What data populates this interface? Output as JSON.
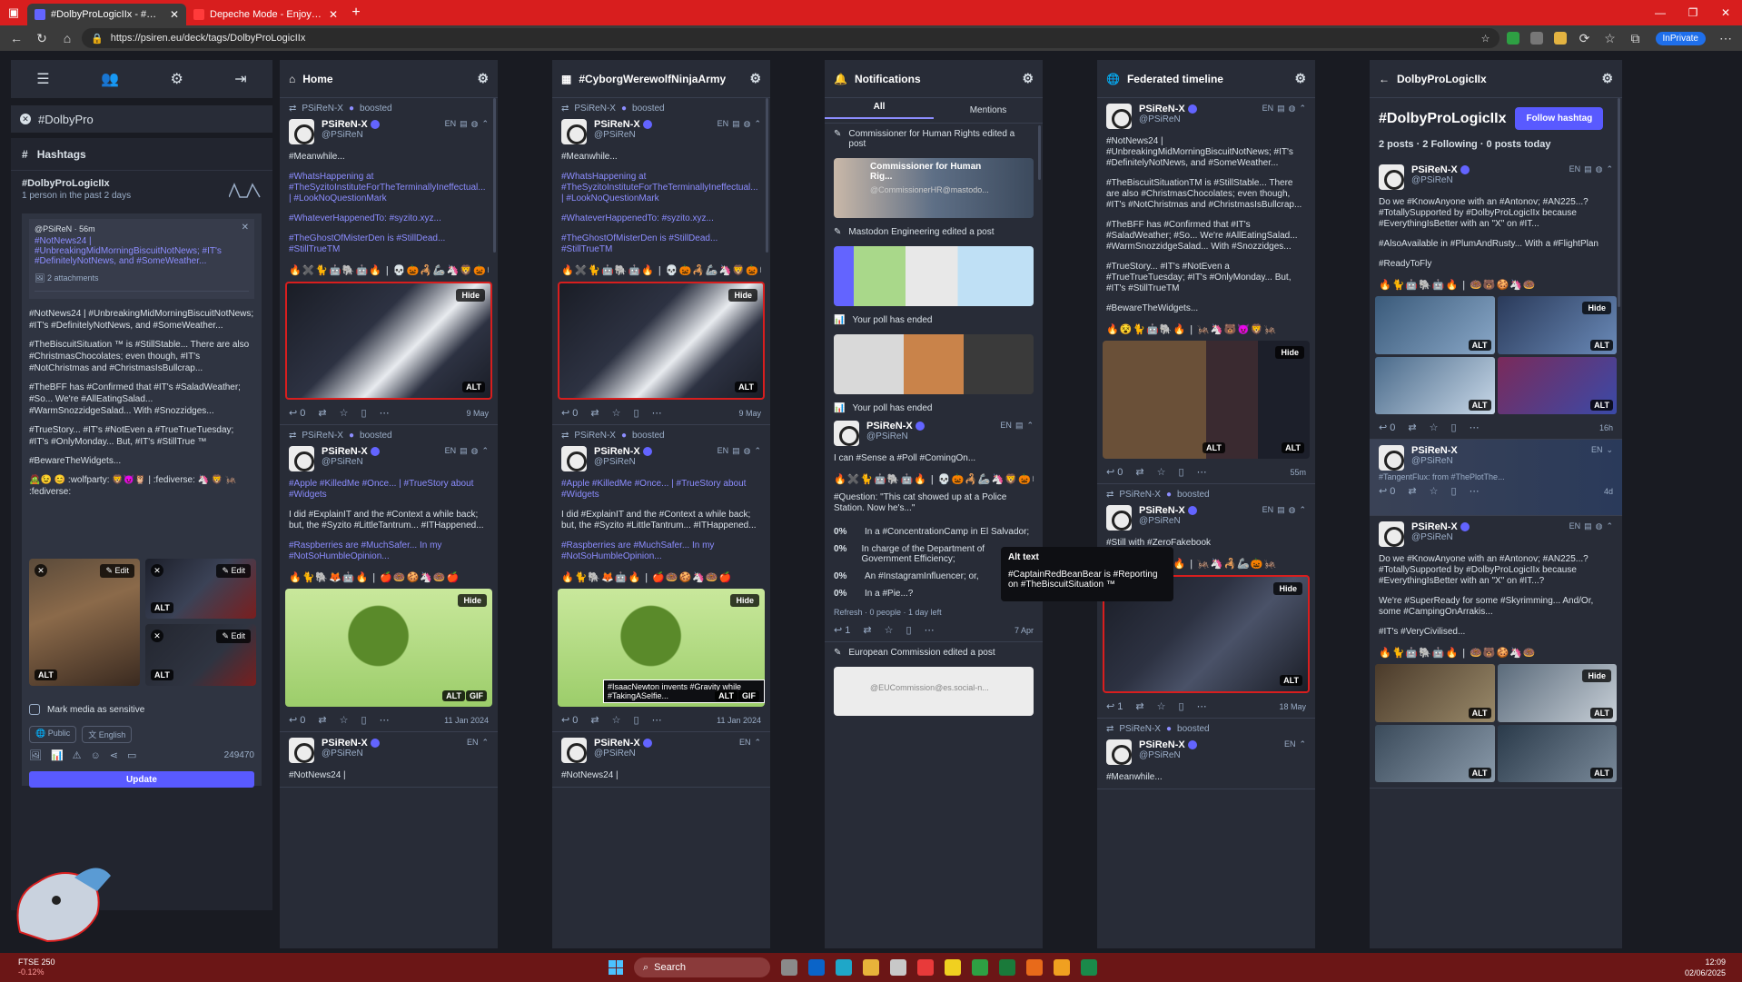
{
  "browser": {
    "tabs": [
      {
        "label": "#DolbyProLogicIIx - #Mastodon..."
      },
      {
        "label": "Depeche Mode - Enjoy The Silence"
      }
    ],
    "url": "https://psiren.eu/deck/tags/DolbyProLogicIIx",
    "inprivate": "InPrivate"
  },
  "left": {
    "search_chip": "#DolbyPro",
    "hashtags_title": "Hashtags",
    "trend_name": "#DolbyProLogicIIx",
    "trend_sub": "1 person in the past 2 days",
    "reply_header": "@PSiReN · 56m",
    "reply_text": "#NotNews24 | #UnbreakingMidMorningBiscuitNotNews; #IT's #DefinitelyNotNews, and #SomeWeather...",
    "attachments": "2 attachments",
    "compose_paras": [
      "#NotNews24 | #UnbreakingMidMorningBiscuitNotNews; #IT's #DefinitelyNotNews, and #SomeWeather...",
      "#TheBiscuitSituation ™ is #StillStable... There are also #ChristmasChocolates; even though, #IT's #NotChristmas and #ChristmasIsBullcrap...",
      "#TheBFF has #Confirmed that #IT's #SaladWeather; #So... We're #AllEatingSalad... #WarmSnozzidgeSalad... With #Snozzidges...",
      "#TrueStory... #IT's #NotEven a #TrueTrueTuesday; #IT's #OnlyMonday... But, #IT's #StillTrue ™",
      "#BewareTheWidgets...",
      "🧟😉 😊 :wolfparty: 🦁😈🦉 | :fediverse: 🦄 🦁 🦗 :fediverse:"
    ],
    "edit": "Edit",
    "alt": "ALT",
    "sensitive": "Mark media as sensitive",
    "visibility": "Public",
    "language": "English",
    "char_count": "249470",
    "update": "Update"
  },
  "columns": {
    "home": {
      "title": "Home"
    },
    "cyborg": {
      "title": "#CyborgWerewolfNinjaArmy"
    },
    "notifications": {
      "title": "Notifications",
      "tab_all": "All",
      "tab_mentions": "Mentions"
    },
    "federated": {
      "title": "Federated timeline"
    },
    "hashtag": {
      "title": "DolbyProLogicIIx"
    }
  },
  "post": {
    "booster": "PSiReN-X",
    "boosted": "boosted",
    "name": "PSiReN-X",
    "handle": "@PSiReN",
    "lang": "EN",
    "hide": "Hide",
    "alt": "ALT",
    "gif": "GIF",
    "p1": [
      "#Meanwhile...",
      "#WhatsHappening at #TheSyzitoInstituteForTheTerminallyIneffectual... | #LookNoQuestionMark",
      "#WhateverHappenedTo: #syzito.xyz...",
      "#TheGhostOfMisterDen is #StillDead... #StillTrueTM"
    ],
    "p1_emoji": "🔥✖️🐈🤖🐘🤖🔥 | 💀🎃🦂🦾🦄🦁🎃💀",
    "p1_date": "9 May",
    "p1_replies": "0",
    "p2": [
      "#Apple #KilledMe #Once... | #TrueStory about #Widgets",
      "I did #ExplainIT and the #Context a while back; but, the #Syzito #LittleTantrum... #ITHappened...",
      "#Raspberries are #MuchSafer... In my #NotSoHumbleOpinion..."
    ],
    "p2_emoji": "🔥🐈🐘🦊🤖🔥 | 🍎🍩🍪🦄🍩🍎",
    "p2_date": "11 Jan 2024",
    "p2_replies": "0",
    "newton_alt": "#IsaacNewton invents #Gravity while #TakingASelfie...",
    "p3_start": "#NotNews24 |"
  },
  "notifications": {
    "n1": "Commissioner for Human Rights edited a post",
    "n1_card_title": "Commissioner for Human Rig...",
    "n1_card_sub": "@CommissionerHR@mastodo...",
    "n2": "Mastodon Engineering edited a post",
    "n3": "Your poll has ended",
    "n4": "Your poll has ended",
    "poll_text": "I can #Sense a #Poll #ComingOn...",
    "poll_q": "#Question: \"This cat showed up at a Police Station. Now he's...\"",
    "poll_opts": [
      {
        "pct": "0%",
        "label": "In a #ConcentrationCamp in El Salvador;"
      },
      {
        "pct": "0%",
        "label": "In charge of the Department of Government Efficiency;"
      },
      {
        "pct": "0%",
        "label": "An #InstagramInfluencer; or,"
      },
      {
        "pct": "0%",
        "label": "In a #Pie...?"
      }
    ],
    "poll_foot": "Refresh · 0 people · 1 day left",
    "poll_date": "7 Apr",
    "poll_replies": "1",
    "n5": "European Commission edited a post",
    "n5_sub": "@EUCommission@es.social-n...",
    "tooltip_title": "Alt text",
    "tooltip_text": "#CaptainRedBeanBear is #Reporting on #TheBiscuitSituation ™"
  },
  "federated": {
    "paras": [
      "#NotNews24 | #UnbreakingMidMorningBiscuitNotNews; #IT's #DefinitelyNotNews, and #SomeWeather...",
      "#TheBiscuitSituationTM is #StillStable... There are also #ChristmasChocolates; even though, #IT's #NotChristmas and #ChristmasIsBullcrap...",
      "#TheBFF has #Confirmed that #IT's #SaladWeather; #So... We're #AllEatingSalad... #WarmSnozzidgeSalad... With #Snozzidges...",
      "#TrueStory... #IT's #NotEven a #TrueTrueTuesday; #IT's #OnlyMonday... But, #IT's #StillTrueTM",
      "#BewareTheWidgets..."
    ],
    "emoji": "🔥😵🐈🤖🐘🔥 | 🦗🦄🐻😈🦁🦗",
    "date1": "55m",
    "replies1": "0",
    "p2_text": "#Still with #ZeroFakebook",
    "p2_emoji": "🔥😵🐈🤖🐘🔥 | 🦗🦄🦂🦾🎃🦗",
    "date2": "18 May",
    "replies2": "1",
    "p3_start": "#Meanwhile..."
  },
  "hashtag": {
    "tag": "#DolbyProLogicIIx",
    "follow": "Follow hashtag",
    "stats": "2 posts · 2 Following · 0 posts today",
    "p1": [
      "Do we #KnowAnyone with an #Antonov; #AN225...? #TotallySupported by #DolbyProLogicIIx because #EverythingIsBetter with an \"X\" on #IT...",
      "#AlsoAvailable in #PlumAndRusty... With a #FlightPlan",
      "#ReadyToFly"
    ],
    "emoji": "🔥🐈🤖🐘🤖🔥 | 🍩🐻🍪🦄🍩",
    "date1": "16h",
    "replies1": "0",
    "boosted_date": "4d",
    "boosted_text": "#TangentFlux: from #ThePlotThe...",
    "p2": [
      "Do we #KnowAnyone with an #Antonov; #AN225...? #TotallySupported by #DolbyProLogicIIx because #EverythingIsBetter with an \"X\" on #IT...?",
      "We're #SuperReady for some #Skyrimming... And/Or, some #CampingOnArrakis...",
      "#IT's #VeryCivilised..."
    ]
  },
  "taskbar": {
    "ticker_name": "FTSE 250",
    "ticker_change": "-0.12%",
    "search": "Search",
    "time": "12:09",
    "date": "02/06/2025"
  },
  "colors": {
    "accent": "#595aff",
    "titlebar": "#d81e1e",
    "bg": "#191b22",
    "panel": "#282c37"
  }
}
